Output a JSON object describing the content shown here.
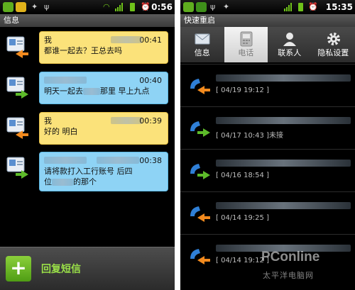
{
  "left_screen": {
    "status_time": "0:56",
    "title": "信息",
    "messages": [
      {
        "sender": "我",
        "time": "00:41",
        "line1": "都谁一起去？王总去吗",
        "line2": "",
        "direction": "out"
      },
      {
        "sender": "",
        "time": "00:40",
        "line1": "明天一起去",
        "line1_tail": "那里 早上九点",
        "line2": "",
        "direction": "in"
      },
      {
        "sender": "我",
        "time": "00:39",
        "line1": "好的 明白",
        "line2": "",
        "direction": "out"
      },
      {
        "sender": "",
        "time": "00:38",
        "line1": "请将款打入工行账号 后四",
        "line2": "位",
        "line2_tail": "的那个",
        "direction": "in"
      }
    ],
    "reply_label": "回复短信"
  },
  "right_screen": {
    "status_time": "15:35",
    "title": "快速重启",
    "tabs": [
      "信息",
      "电话",
      "联系人",
      "隐私设置"
    ],
    "selected_tab": 1,
    "calls": [
      {
        "meta": "[ 04/19 19:12 ]",
        "type": "outgoing"
      },
      {
        "meta": "[ 04/17 10:43 ]未接",
        "type": "incoming"
      },
      {
        "meta": "[ 04/16 18:54 ]",
        "type": "incoming"
      },
      {
        "meta": "[ 04/14 19:25 ]",
        "type": "outgoing"
      },
      {
        "meta": "[ 04/14 19:12 ]",
        "type": "outgoing"
      }
    ]
  },
  "watermark": {
    "brand": "PConline",
    "sub": "太平洋电脑网"
  },
  "colors": {
    "outgoing_bubble": "#fbe27a",
    "incoming_bubble": "#8ed3f5",
    "accent_green": "#9ae048",
    "call_blue": "#2f7fd6",
    "arrow_orange": "#f28a1e",
    "arrow_green": "#5dbb2a"
  }
}
